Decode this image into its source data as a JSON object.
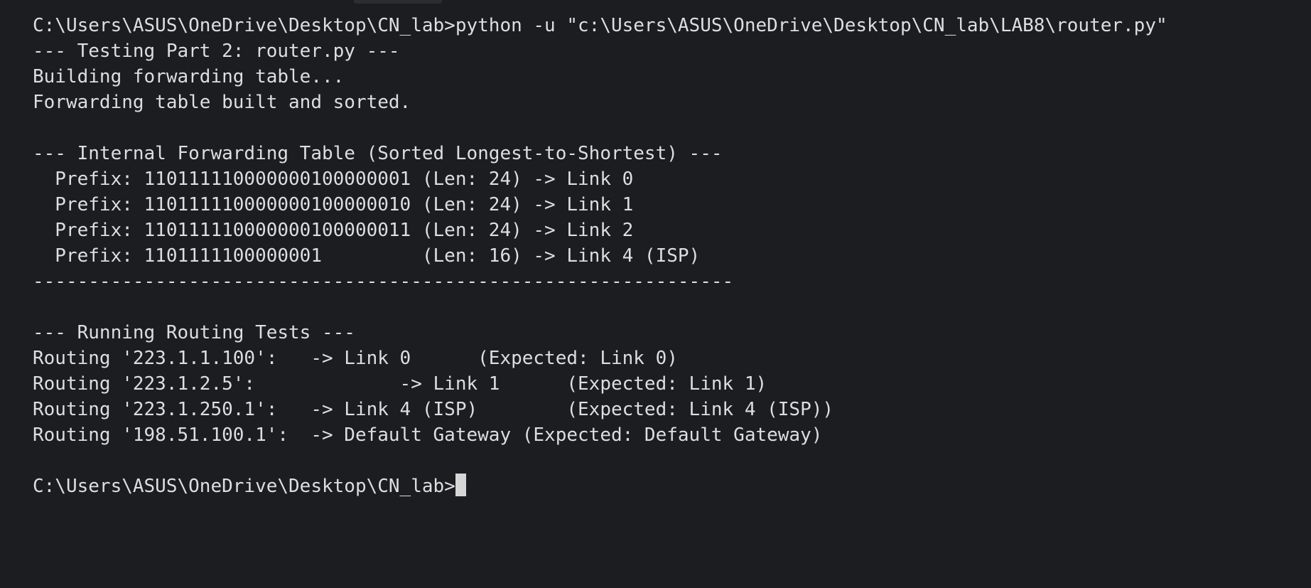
{
  "terminal": {
    "lines": [
      "C:\\Users\\ASUS\\OneDrive\\Desktop\\CN_lab>python -u \"c:\\Users\\ASUS\\OneDrive\\Desktop\\CN_lab\\LAB8\\router.py\"",
      "--- Testing Part 2: router.py ---",
      "Building forwarding table...",
      "Forwarding table built and sorted.",
      "",
      "--- Internal Forwarding Table (Sorted Longest-to-Shortest) ---",
      "  Prefix: 110111110000000100000001 (Len: 24) -> Link 0",
      "  Prefix: 110111110000000100000010 (Len: 24) -> Link 1",
      "  Prefix: 110111110000000100000011 (Len: 24) -> Link 2",
      "  Prefix: 1101111100000001         (Len: 16) -> Link 4 (ISP)",
      "---------------------------------------------------------------",
      "",
      "--- Running Routing Tests ---",
      "Routing '223.1.1.100':   -> Link 0      (Expected: Link 0)",
      "Routing '223.1.2.5':             -> Link 1      (Expected: Link 1)",
      "Routing '223.1.250.1':   -> Link 4 (ISP)        (Expected: Link 4 (ISP))",
      "Routing '198.51.100.1':  -> Default Gateway (Expected: Default Gateway)",
      ""
    ],
    "prompt": "C:\\Users\\ASUS\\OneDrive\\Desktop\\CN_lab>"
  }
}
